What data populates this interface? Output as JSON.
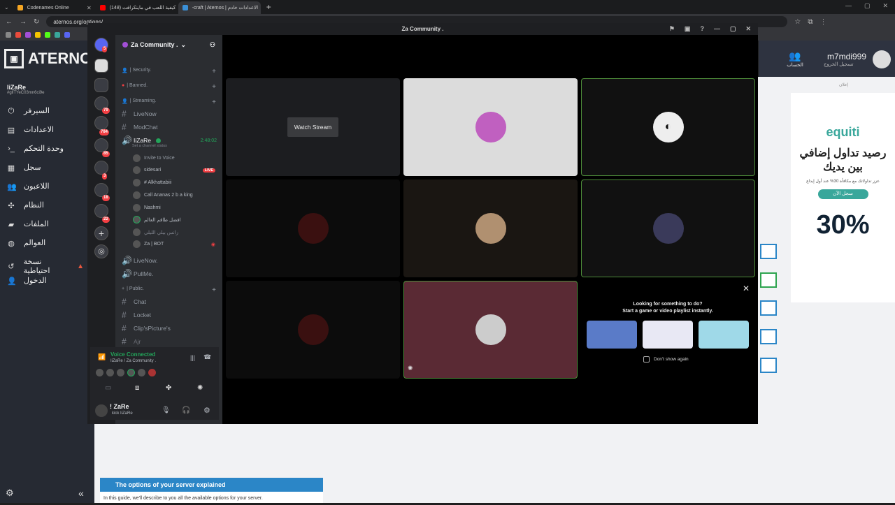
{
  "browser": {
    "tabs": [
      {
        "title": "Codenames Online",
        "color": "#f5a623"
      },
      {
        "title": "(148) كيفية اللعب في ماينكرافت",
        "color": "#ff0000"
      },
      {
        "title": "-craft | Aternos | الاعدادات خادم",
        "color": "#3a8fd6",
        "active": true
      }
    ],
    "url": "aternos.org/options/"
  },
  "aternos": {
    "logo": "ATERNOS",
    "server_name": "IiZaRe",
    "server_id": "#gllTYeC03mn6ci9e",
    "nav": [
      "السيرفر",
      "الاعدادات",
      "وحدة التحكم",
      "سجل",
      "اللاعبون",
      "النظام",
      "الملفات",
      "العوالم",
      "نسخة احتياطية",
      "الدخول"
    ],
    "username": "m7mdi999",
    "logout": "تسجيل الخروج",
    "account": "الحساب",
    "ad_label": "إعلان",
    "ad": {
      "brand": "equiti",
      "headline": "رصيد تداول إضافي بين يديك",
      "sub": "عزز تداولاتك مع مكافأة 30% عند أول إيداع",
      "cta": "سجل الآن",
      "percent": "30%"
    },
    "guide_title": "The options of your server explained",
    "guide_text": "In this guide, we'll describe to you all the available options for your server."
  },
  "discord": {
    "window_title": "Za Community .",
    "server_name": "Za Community .",
    "categories": [
      {
        "label": "| Security."
      },
      {
        "label": "| Banned."
      },
      {
        "label": "| Streaming."
      },
      {
        "label": "| Public."
      }
    ],
    "channels": {
      "liveNow": "LiveNow",
      "modChat": "ModChat",
      "voice": "IiZaRe",
      "voice_time": "2:48:02",
      "status_hint": "Set a channel status",
      "liveNow2": "LiveNow.",
      "pullMe": "PullMe.",
      "chat": "Chat",
      "locket": "Locket",
      "clips": "Clip'sPicture's",
      "ajr": "Ajr"
    },
    "voice_users": [
      {
        "name": "Invite to Voice"
      },
      {
        "name": "sidesari",
        "live": "LIVE"
      },
      {
        "name": "# Alkhattabiii"
      },
      {
        "name": "Call Ananas 2 b a king"
      },
      {
        "name": "Nashmi"
      },
      {
        "name": "افضل طاقم العالم"
      },
      {
        "name": "زانس بيلي الليلي"
      },
      {
        "name": "Za | BOT"
      }
    ],
    "voice_panel": {
      "title": "Voice Connected",
      "sub": "IiZaRe / Za Community ."
    },
    "me": {
      "name": "! ZaRe",
      "status": "kick IiZaRe"
    },
    "stage": {
      "watch": "Watch Stream"
    },
    "promo": {
      "line1": "Looking for something to do?",
      "line2": "Start a game or video playlist instantly.",
      "dont_show": "Don't show again"
    },
    "badges": [
      "5",
      "79",
      "784",
      "85",
      "3",
      "18",
      "22"
    ]
  }
}
